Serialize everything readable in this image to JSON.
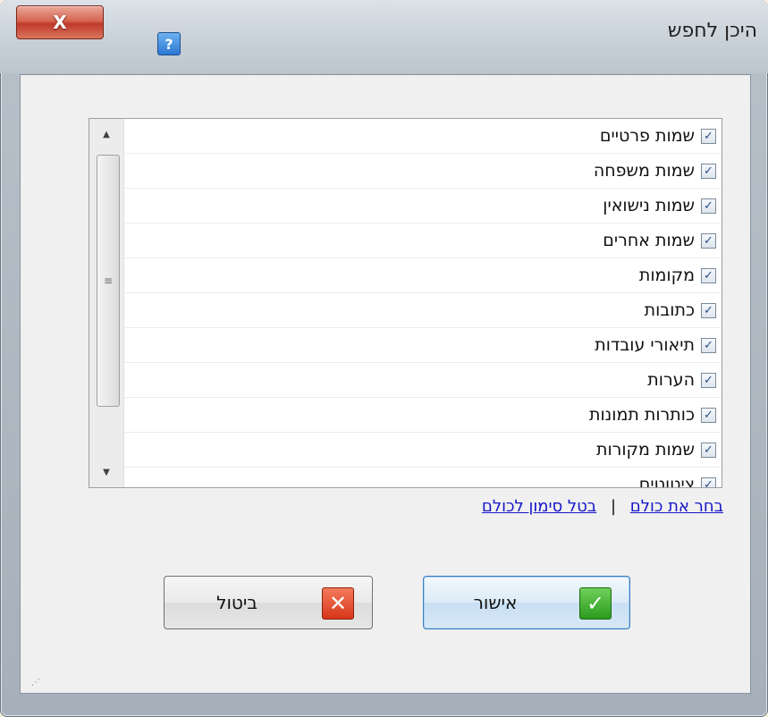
{
  "window": {
    "title": "היכן לחפש",
    "close_label": "X",
    "help_label": "?"
  },
  "list": {
    "items": [
      {
        "label": "שמות פרטיים",
        "checked": true
      },
      {
        "label": "שמות משפחה",
        "checked": true
      },
      {
        "label": "שמות נישואין",
        "checked": true
      },
      {
        "label": "שמות אחרים",
        "checked": true
      },
      {
        "label": "מקומות",
        "checked": true
      },
      {
        "label": "כתובות",
        "checked": true
      },
      {
        "label": "תיאורי עובדות",
        "checked": true
      },
      {
        "label": "הערות",
        "checked": true
      },
      {
        "label": "כותרות תמונות",
        "checked": true
      },
      {
        "label": "שמות מקורות",
        "checked": true
      },
      {
        "label": "ציטוטים",
        "checked": true
      }
    ],
    "check_glyph": "✓",
    "scroll_up_glyph": "▲",
    "scroll_down_glyph": "▼",
    "thumb_grip": "≡"
  },
  "links": {
    "select_all": "בחר את כולם",
    "separator": "|",
    "deselect_all": "בטל סימון לכולם"
  },
  "buttons": {
    "ok_label": "אישור",
    "ok_icon": "✓",
    "cancel_label": "ביטול",
    "cancel_icon": "✕"
  },
  "colors": {
    "link": "#1515c9",
    "ok_icon": "#2c9a1e",
    "cancel_icon": "#d8361a"
  }
}
